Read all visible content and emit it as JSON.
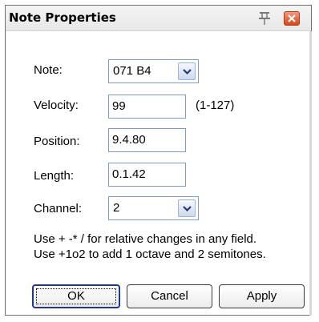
{
  "dialog": {
    "title": "Note Properties"
  },
  "fields": {
    "note": {
      "label": "Note:",
      "value": "071 B4"
    },
    "velocity": {
      "label": "Velocity:",
      "value": "99",
      "range": "(1-127)"
    },
    "position": {
      "label": "Position:",
      "value": "9.4.80"
    },
    "length": {
      "label": "Length:",
      "value": "0.1.42"
    },
    "channel": {
      "label": "Channel:",
      "value": "2"
    }
  },
  "help": {
    "line1": "Use + -* / for relative changes in any field.",
    "line2": "Use +1o2  to add 1 octave and 2 semitones."
  },
  "buttons": {
    "ok": "OK",
    "cancel": "Cancel",
    "apply": "Apply"
  },
  "icons": {
    "pin": "pin-icon",
    "close": "close-icon",
    "dropdown": "chevron-down-icon"
  }
}
